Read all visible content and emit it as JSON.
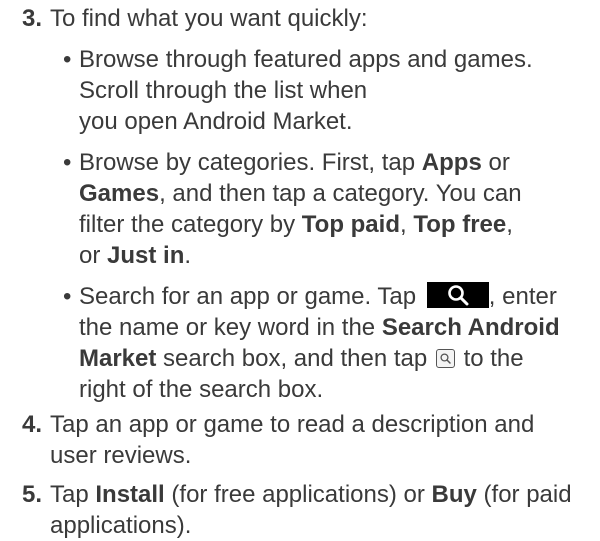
{
  "step3": {
    "number": "3.",
    "text": "To find what you want quickly:"
  },
  "bullet1": {
    "line1": "Browse through featured apps and games.",
    "line2": "Scroll through the list when",
    "line3": "you open Android Market."
  },
  "bullet2": {
    "line1_pre": "Browse by categories. First, tap ",
    "line1_bold": "Apps",
    "line1_post": " or",
    "line2_bold": "Games",
    "line2_post": ", and then tap a category. You can",
    "line3_pre": "filter the category by ",
    "line3_bold1": "Top paid",
    "line3_sep": ", ",
    "line3_bold2": "Top free",
    "line3_post": ",",
    "line4_pre": "or ",
    "line4_bold": "Just in",
    "line4_post": "."
  },
  "bullet3": {
    "line1_pre": "Search for an app or game. Tap ",
    "line1_post": ", enter",
    "line2_pre": "the name or key word in the ",
    "line2_bold": "Search Android",
    "line3_bold": "Market",
    "line3_mid": " search box, and then tap ",
    "line3_post": " to the",
    "line4": "right of the search box."
  },
  "step4": {
    "number": "4.",
    "line1": "Tap an app or game to read a description and",
    "line2": "user reviews."
  },
  "step5": {
    "number": "5.",
    "line1_pre": "Tap ",
    "line1_bold1": "Install",
    "line1_mid": " (for free applications) or ",
    "line1_bold2": "Buy",
    "line1_post": " (for paid",
    "line2": "applications)."
  },
  "bullet_char": "•",
  "icons": {
    "search_button": "search-button-icon",
    "search_small": "search-small-icon"
  },
  "colors": {
    "text": "#3a3a3a",
    "icon_bg": "#000000"
  }
}
